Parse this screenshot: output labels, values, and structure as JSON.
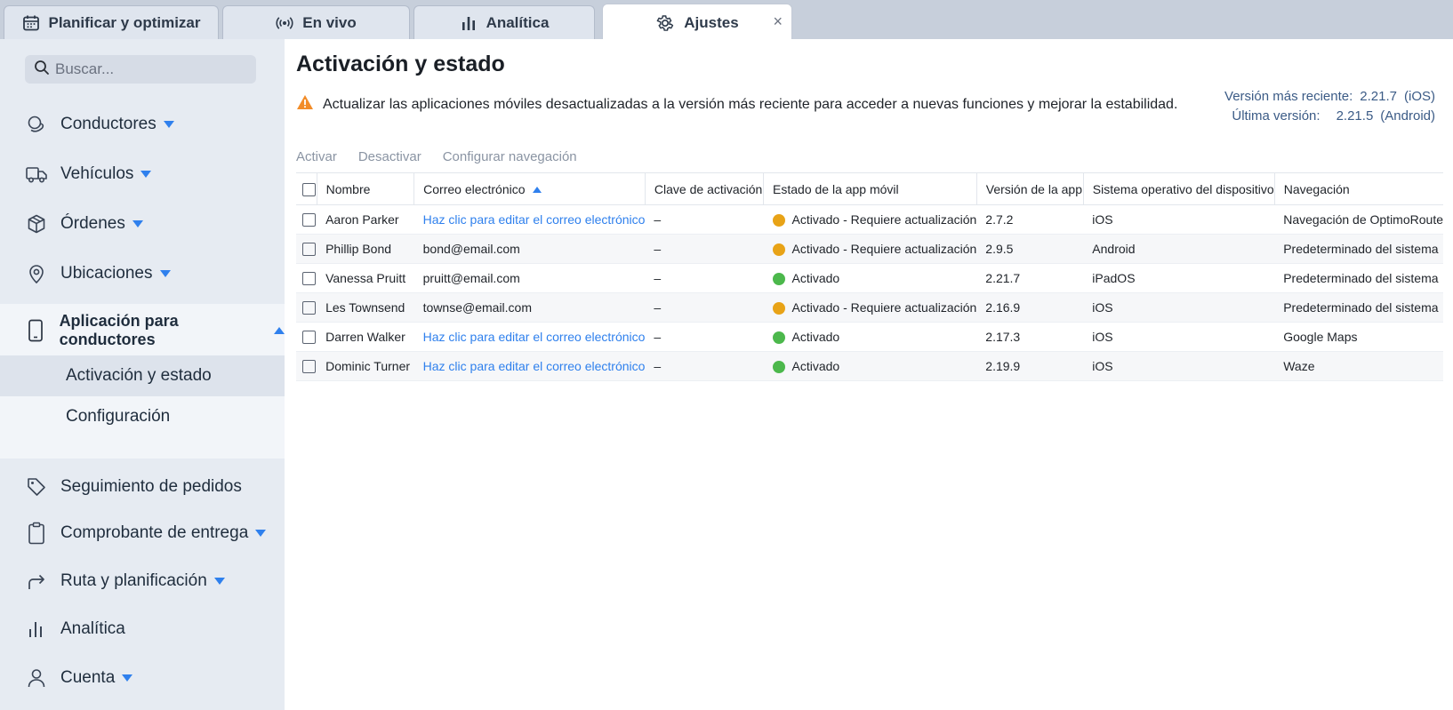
{
  "tabs": [
    {
      "label": "Planificar y optimizar",
      "icon": "calendar-icon"
    },
    {
      "label": "En vivo",
      "icon": "broadcast-icon"
    },
    {
      "label": "Analítica",
      "icon": "bar-chart-icon"
    },
    {
      "label": "Ajustes",
      "icon": "gear-icon",
      "active": true,
      "close": "×"
    }
  ],
  "sidebar": {
    "search_placeholder": "Buscar...",
    "items": [
      {
        "label": "Conductores",
        "icon": "drivers-icon"
      },
      {
        "label": "Vehículos",
        "icon": "truck-icon"
      },
      {
        "label": "Órdenes",
        "icon": "box-icon"
      },
      {
        "label": "Ubicaciones",
        "icon": "location-pin-icon"
      },
      {
        "label": "Aplicación para conductores",
        "icon": "mobile-phone-icon"
      },
      {
        "label": "Seguimiento de pedidos",
        "icon": "tag-icon"
      },
      {
        "label": "Comprobante de entrega",
        "icon": "clipboard-icon"
      },
      {
        "label": "Ruta y planificación",
        "icon": "route-arrow-icon"
      },
      {
        "label": "Analítica",
        "icon": "bar-chart-icon"
      },
      {
        "label": "Cuenta",
        "icon": "user-icon"
      }
    ],
    "subitems": [
      {
        "label": "Activación y estado",
        "selected": true
      },
      {
        "label": "Configuración"
      }
    ]
  },
  "main": {
    "title": "Activación y estado",
    "warning": "Actualizar las aplicaciones móviles desactualizadas a la versión más reciente para acceder a nuevas funciones y mejorar la estabilidad.",
    "versions": {
      "latest_label": "Versión más reciente:",
      "latest_value": "2.21.7",
      "latest_platform": "(iOS)",
      "last_label": "Última versión:",
      "last_value": "2.21.5",
      "last_platform": "(Android)"
    },
    "toolbar": {
      "activate": "Activar",
      "deactivate": "Desactivar",
      "configure_nav": "Configurar navegación"
    },
    "table": {
      "columns": [
        "Nombre",
        "Correo electrónico",
        "Clave de activación",
        "Estado de la app móvil",
        "Versión de la app",
        "Sistema operativo del dispositivo",
        "Navegación"
      ],
      "rows": [
        {
          "name": "Aaron Parker",
          "email": "Haz clic para editar el correo electrónico",
          "email_link": true,
          "key": "–",
          "status": "Activado - Requiere actualización",
          "status_color": "#e8a317",
          "version": "2.7.2",
          "os": "iOS",
          "nav": "Navegación de OptimoRoute"
        },
        {
          "name": "Phillip Bond",
          "email": "bond@email.com",
          "email_link": false,
          "key": "–",
          "status": "Activado - Requiere actualización",
          "status_color": "#e8a317",
          "version": "2.9.5",
          "os": "Android",
          "nav": "Predeterminado del sistema"
        },
        {
          "name": "Vanessa Pruitt",
          "email": "pruitt@email.com",
          "email_link": false,
          "key": "–",
          "status": "Activado",
          "status_color": "#4cb84c",
          "version": "2.21.7",
          "os": "iPadOS",
          "nav": "Predeterminado del sistema"
        },
        {
          "name": "Les Townsend",
          "email": "townse@email.com",
          "email_link": false,
          "key": "–",
          "status": "Activado - Requiere actualización",
          "status_color": "#e8a317",
          "version": "2.16.9",
          "os": "iOS",
          "nav": "Predeterminado del sistema"
        },
        {
          "name": "Darren Walker",
          "email": "Haz clic para editar el correo electrónico",
          "email_link": true,
          "key": "–",
          "status": "Activado",
          "status_color": "#4cb84c",
          "version": "2.17.3",
          "os": "iOS",
          "nav": "Google Maps"
        },
        {
          "name": "Dominic Turner",
          "email": "Haz clic para editar el correo electrónico",
          "email_link": true,
          "key": "–",
          "status": "Activado",
          "status_color": "#4cb84c",
          "version": "2.19.9",
          "os": "iOS",
          "nav": "Waze"
        }
      ]
    }
  },
  "colors": {
    "accent": "#2f80ed",
    "warning": "#f28c28",
    "needs_update": "#e8a317",
    "activated": "#4cb84c"
  }
}
